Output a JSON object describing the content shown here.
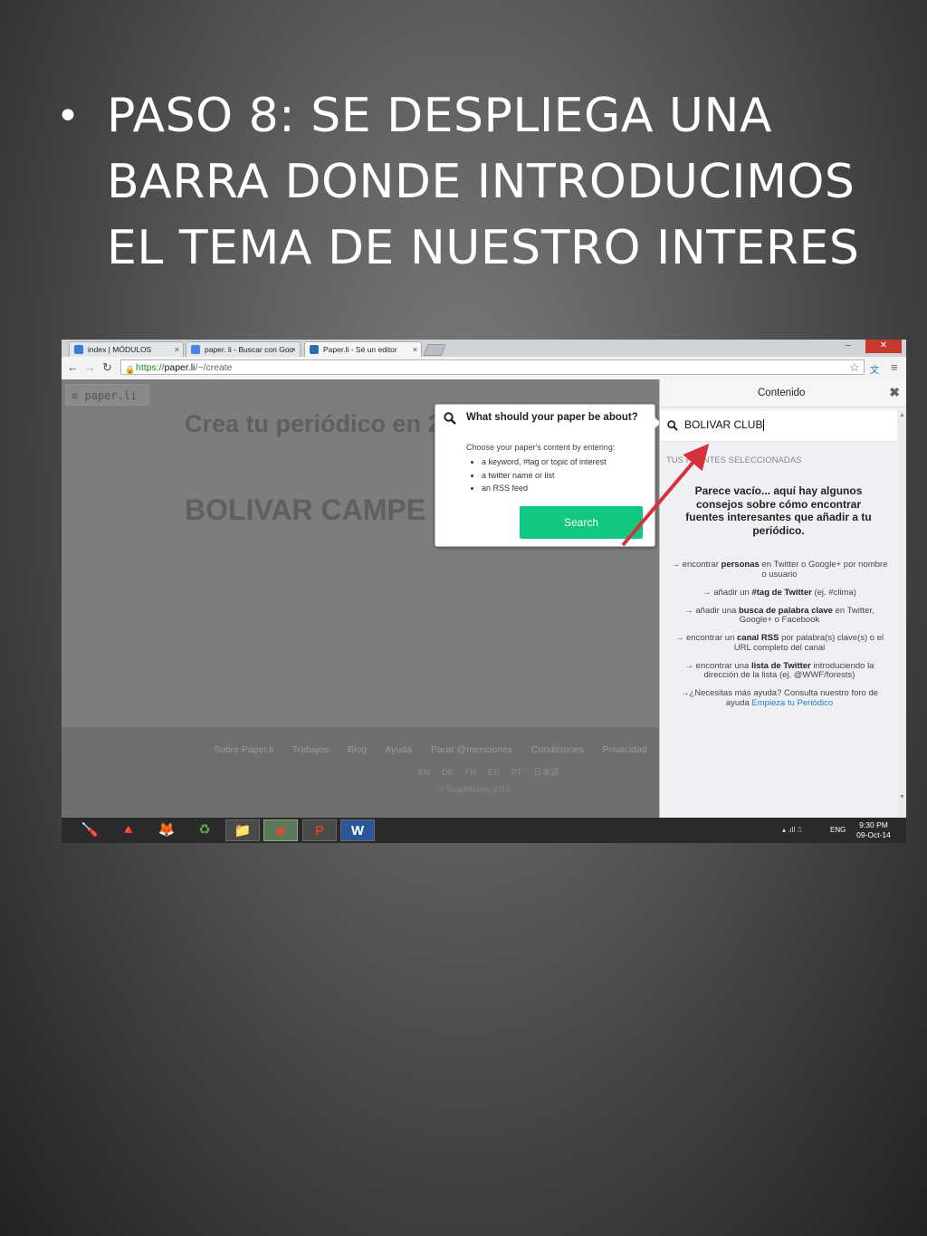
{
  "slide": {
    "bullet": "•",
    "title_lines": [
      "PASO 8: SE DESPLIEGA UNA",
      "BARRA DONDE INTRODUCIMOS",
      "EL TEMA DE NUESTRO INTERES"
    ]
  },
  "browser": {
    "tabs": [
      {
        "label": "index | MÓDULOS",
        "close": "×"
      },
      {
        "label": "paper. li - Buscar con Goo",
        "close": "×"
      },
      {
        "label": "Paper.li - Sé un editor",
        "close": "×"
      }
    ],
    "window_controls": {
      "minimize": "–",
      "maximize": "▫",
      "close": "✕"
    },
    "url_scheme": "https://",
    "url_host": "paper.li",
    "url_path": "/~/create",
    "nav": {
      "back": "←",
      "forward": "→",
      "reload": "↻"
    },
    "toolbar_icons": {
      "star": "☆",
      "translate": "文",
      "menu": "≡"
    }
  },
  "page": {
    "logo": "≡ paper.li",
    "headline": "Crea tu periódico en 2",
    "paper_name": "BOLIVAR CAMPE",
    "footer_links": [
      "Sobre Paper.li",
      "Trabajos",
      "Blog",
      "Ayuda",
      "Parar @menciones",
      "Condiciones",
      "Privacidad",
      "🐦"
    ],
    "footer_langs": [
      "EN",
      "DE",
      "FR",
      "ES",
      "PT",
      "日本語"
    ],
    "footer_copy": "© SmallRivers 2014"
  },
  "popup": {
    "title": "What should your paper be about?",
    "subtitle": "Choose your paper's content by entering:",
    "items": [
      "a keyword, #tag or topic of interest",
      "a twitter name or list",
      "an RSS feed"
    ],
    "search_label": "Search"
  },
  "panel": {
    "title": "Contenido",
    "close": "✖",
    "search_value": "BOLIVAR CLUB",
    "selected_label": "TUS FUENTES SELECCIONADAS",
    "empty_title": "Parece vacío... aquí hay algunos consejos sobre cómo encontrar fuentes interesantes que añadir a tu periódico.",
    "tips": [
      {
        "pre": "→ encontrar ",
        "bold": "personas",
        "post": " en Twitter o Google+ por nombre o usuario"
      },
      {
        "pre": "→ añadir un ",
        "bold": "#tag de Twitter",
        "post": " (ej. #clima)"
      },
      {
        "pre": "→ añadir una ",
        "bold": "busca de palabra clave",
        "post": " en Twitter, Google+ o Facebook"
      },
      {
        "pre": "→ encontrar un ",
        "bold": "canal RSS",
        "post": " por palabra(s) clave(s) o el URL completo del canal"
      },
      {
        "pre": "→ encontrar una ",
        "bold": "lista de Twitter",
        "post": " introduciendo la dirección de la lista (ej. @WWF/forests)"
      }
    ],
    "help_pre": "→¿Necesitas más ayuda? Consulta nuestro foro de ayuda ",
    "help_link": "Empieza tu Periódico",
    "scroll_up": "▲",
    "scroll_down": "▼"
  },
  "taskbar": {
    "apps": [
      "🪛",
      "🔺",
      "🦊",
      "♻",
      "📁",
      "◉",
      "P",
      "W"
    ],
    "tray": "▴  .ıll  ⎍",
    "lang": "ENG",
    "time": "9:30 PM",
    "date": "09-Oct-14"
  },
  "colors": {
    "annotation_arrow": "#d6303a",
    "search_button": "#12c880",
    "link": "#1e7fc4"
  }
}
